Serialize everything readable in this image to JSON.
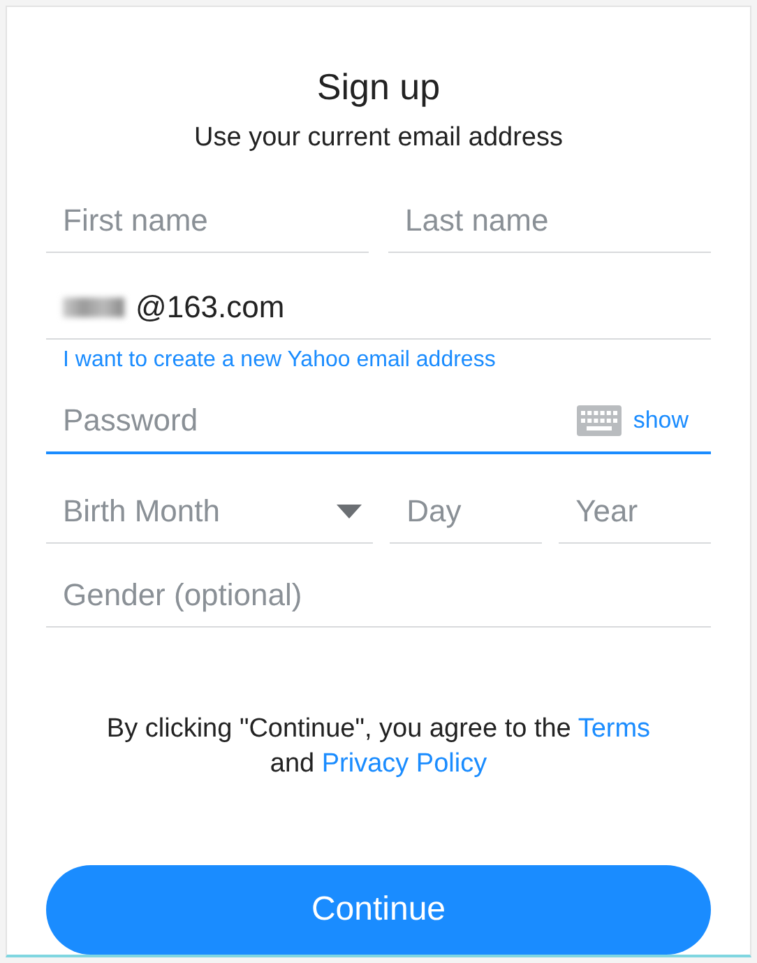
{
  "title": "Sign up",
  "subtitle": "Use your current email address",
  "name_fields": [
    {
      "placeholder": "First name"
    },
    {
      "placeholder": "Last name"
    }
  ],
  "email": {
    "value": "@163.com",
    "redacted": true
  },
  "alt_link": "I want to create a new Yahoo email address",
  "password": {
    "placeholder": "Password",
    "focused": true,
    "toggle": "show"
  },
  "birth_fields": [
    {
      "kind": "select",
      "placeholder": "Birth Month"
    },
    {
      "kind": "text",
      "placeholder": "Day"
    },
    {
      "kind": "text",
      "placeholder": "Year"
    }
  ],
  "gender": {
    "placeholder": "Gender (optional)"
  },
  "terms": {
    "before": "By clicking \"Continue\", you agree to the",
    "terms_link": "Terms",
    "middle": "and",
    "privacy_link": "Privacy Policy"
  },
  "continue_button": "Continue"
}
